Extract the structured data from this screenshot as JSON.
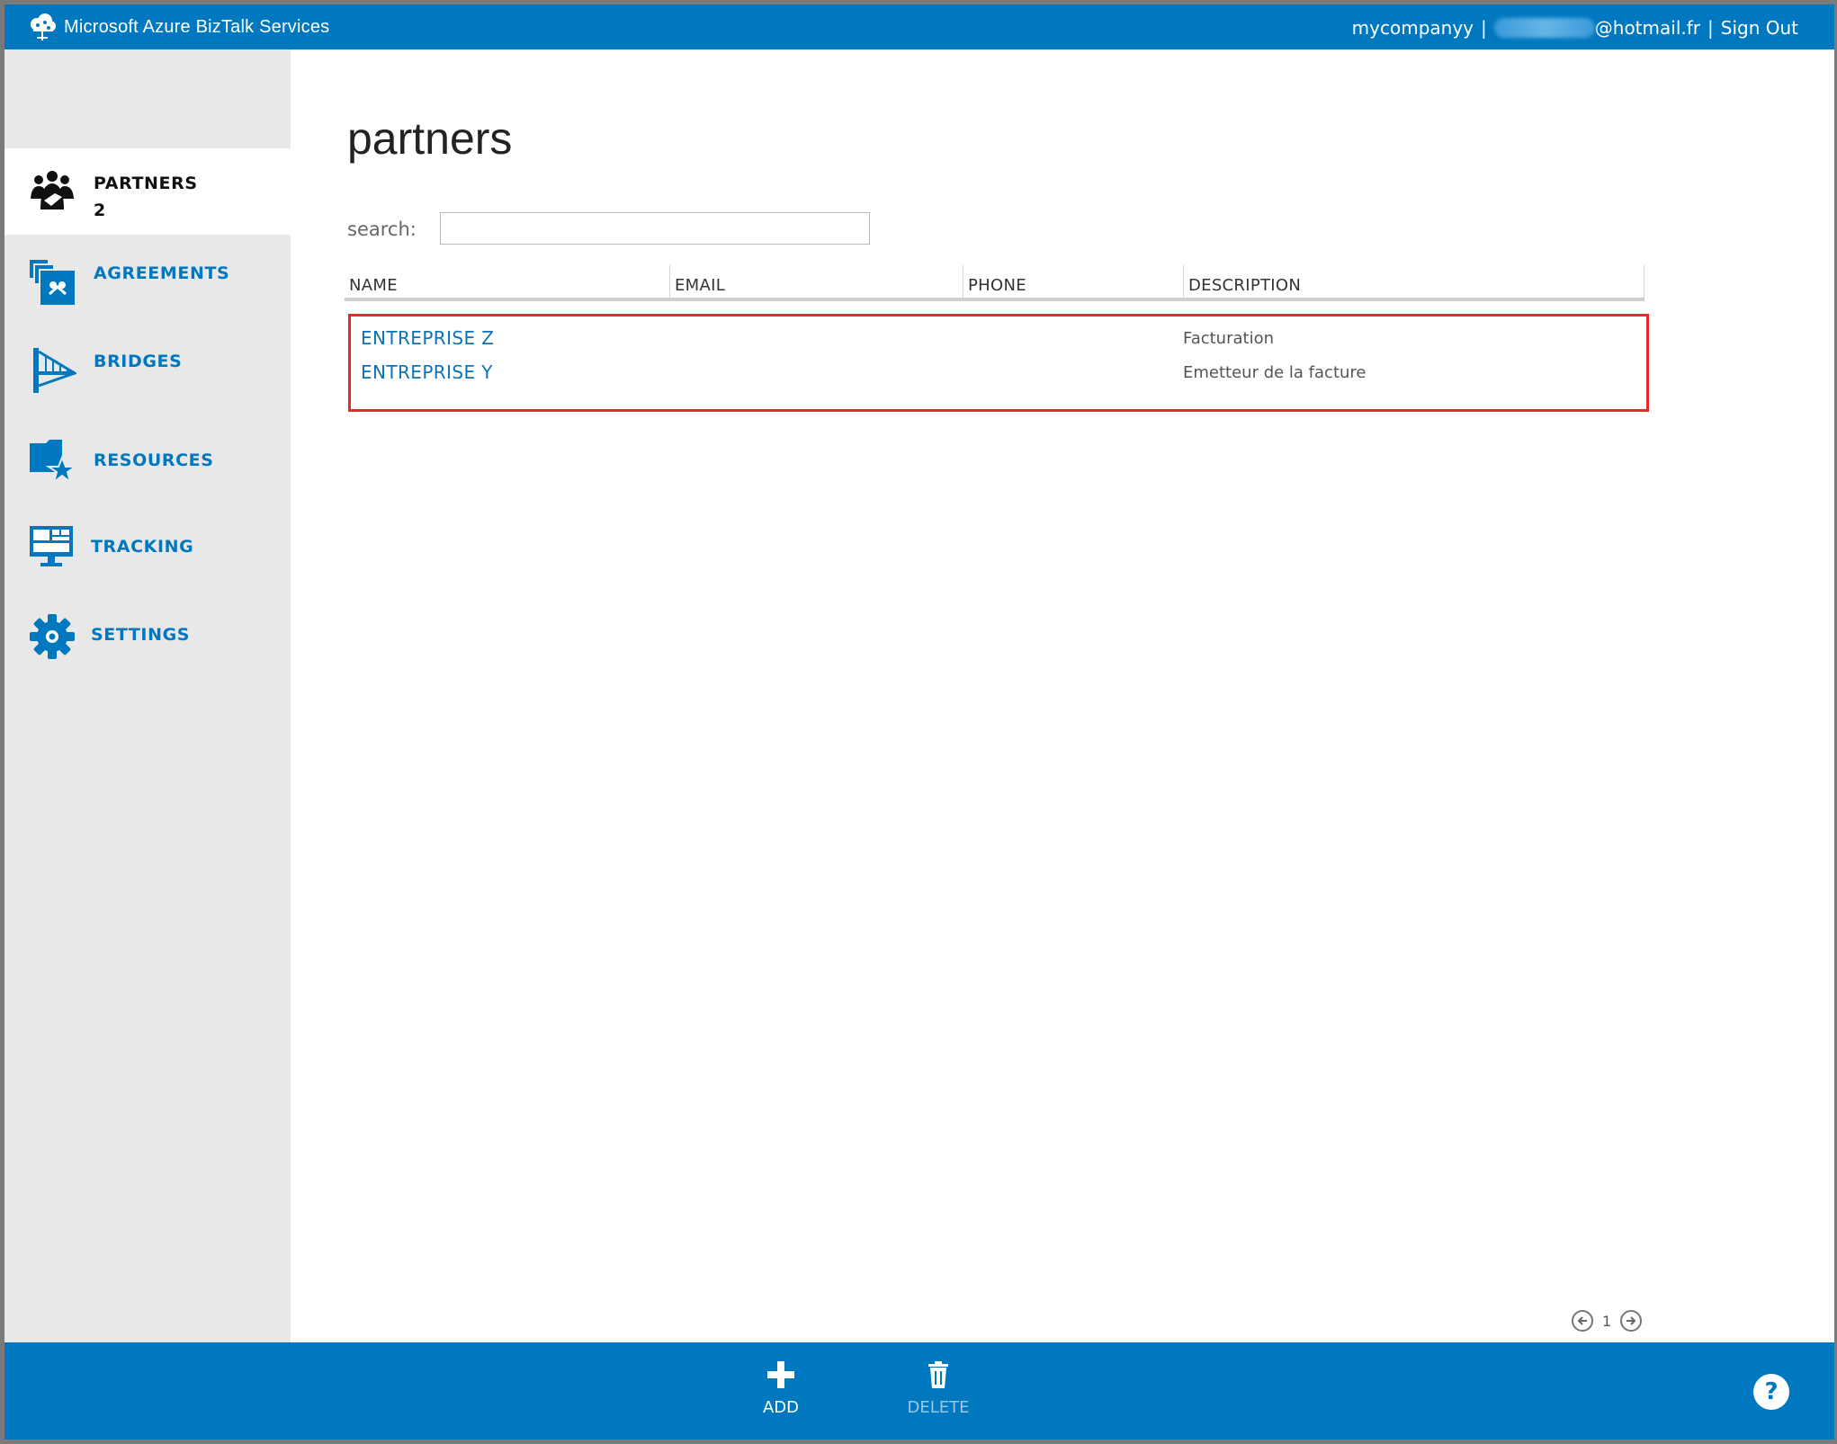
{
  "header": {
    "app_title": "Microsoft Azure BizTalk Services",
    "account": "mycompanyy",
    "email_suffix": "@hotmail.fr",
    "separator": "|",
    "sign_out": "Sign Out"
  },
  "sidebar": {
    "items": [
      {
        "label": "PARTNERS",
        "count": "2",
        "icon": "partners-icon",
        "active": true
      },
      {
        "label": "AGREEMENTS",
        "icon": "agreements-icon"
      },
      {
        "label": "BRIDGES",
        "icon": "bridge-icon"
      },
      {
        "label": "RESOURCES",
        "icon": "resources-icon"
      },
      {
        "label": "TRACKING",
        "icon": "tracking-icon"
      },
      {
        "label": "SETTINGS",
        "icon": "gear-icon"
      }
    ]
  },
  "main": {
    "title": "partners",
    "search_label": "search:",
    "search_value": "",
    "columns": [
      "NAME",
      "EMAIL",
      "PHONE",
      "DESCRIPTION"
    ],
    "rows": [
      {
        "name": "ENTREPRISE Z",
        "email": "",
        "phone": "",
        "description": "Facturation"
      },
      {
        "name": "ENTREPRISE Y",
        "email": "",
        "phone": "",
        "description": "Emetteur de la facture"
      }
    ],
    "pager": {
      "page": "1"
    }
  },
  "commands": {
    "add": "ADD",
    "delete": "DELETE",
    "help": "?"
  },
  "colors": {
    "brand": "#0078bf",
    "highlight": "#e22b2b",
    "sidebar": "#e8e8e8"
  }
}
